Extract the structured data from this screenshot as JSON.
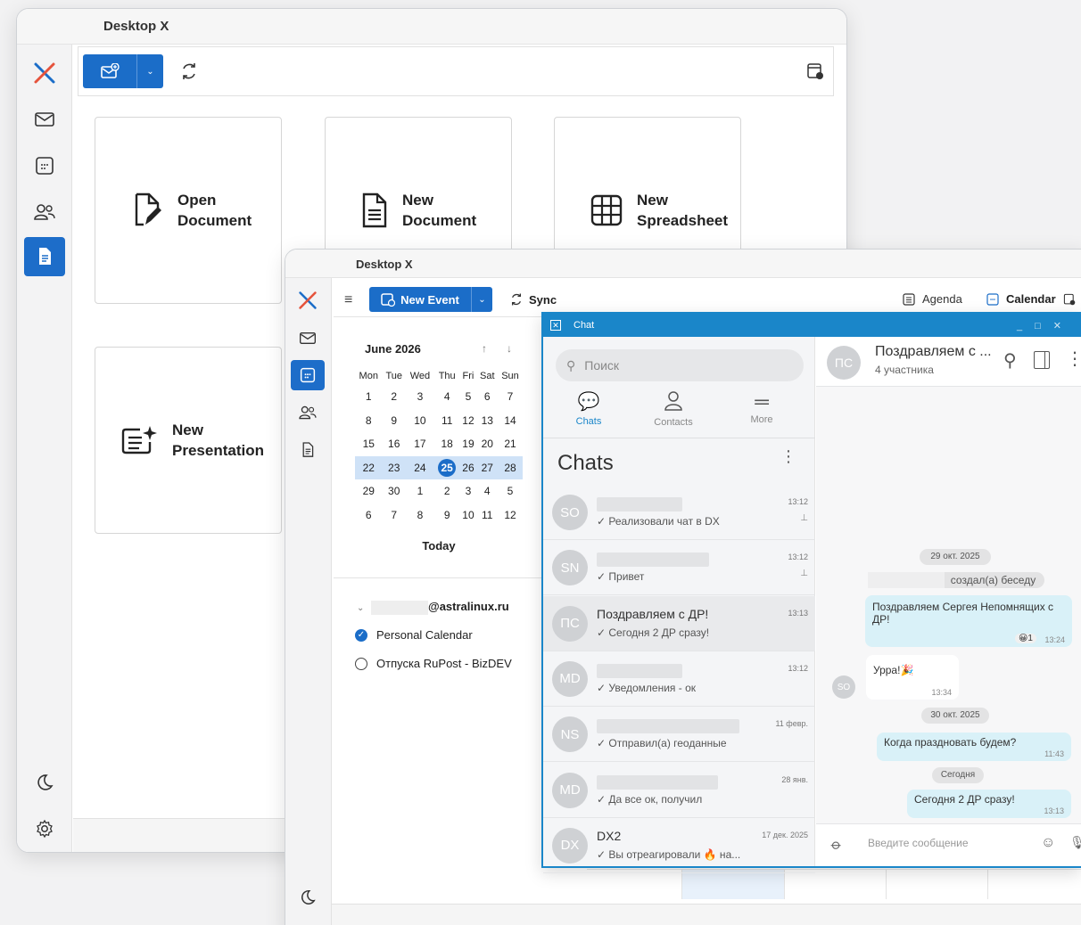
{
  "win1": {
    "title": "Desktop X",
    "tiles": [
      {
        "label": "Open\nDocument",
        "icon": "open-document-icon"
      },
      {
        "label": "New\nDocument",
        "icon": "new-document-icon"
      },
      {
        "label": "New\nSpreadsheet",
        "icon": "spreadsheet-icon"
      },
      {
        "label": "New\nPresentation",
        "icon": "presentation-icon"
      }
    ]
  },
  "win2": {
    "title": "Desktop X",
    "new_event": "New Event",
    "sync": "Sync",
    "agenda": "Agenda",
    "calendar": "Calendar",
    "month_label": "June 2026",
    "weekdays": [
      "Mon",
      "Tue",
      "Wed",
      "Thu",
      "Fri",
      "Sat",
      "Sun"
    ],
    "weeks": [
      [
        "1",
        "2",
        "3",
        "4",
        "5",
        "6",
        "7"
      ],
      [
        "8",
        "9",
        "10",
        "11",
        "12",
        "13",
        "14"
      ],
      [
        "15",
        "16",
        "17",
        "18",
        "19",
        "20",
        "21"
      ],
      [
        "22",
        "23",
        "24",
        "25",
        "26",
        "27",
        "28"
      ],
      [
        "29",
        "30",
        "1",
        "2",
        "3",
        "4",
        "5"
      ],
      [
        "6",
        "7",
        "8",
        "9",
        "10",
        "11",
        "12"
      ]
    ],
    "today_btn": "Today",
    "account_suffix": "@astralinux.ru",
    "calendars": [
      {
        "name": "Personal Calendar",
        "checked": true
      },
      {
        "name": "Отпуска RuPost - BizDEV",
        "checked": false
      }
    ]
  },
  "chat": {
    "window_title": "Chat",
    "search_placeholder": "Поиск",
    "tabs": [
      {
        "label": "Chats",
        "active": true
      },
      {
        "label": "Contacts",
        "active": false
      },
      {
        "label": "More",
        "active": false
      }
    ],
    "list_title": "Chats",
    "items": [
      {
        "initials": "SO",
        "name": "",
        "message": "✓ Реализовали чат в DX",
        "time": "13:12",
        "pinned": true,
        "color": "#cfd1d4"
      },
      {
        "initials": "SN",
        "name": "",
        "message": "✓ Привет",
        "time": "13:12",
        "pinned": true,
        "color": "#cfd1d4"
      },
      {
        "initials": "ПС",
        "name": "Поздравляем с ДР!",
        "message": "✓ Сегодня 2 ДР сразу!",
        "time": "13:13",
        "pinned": false,
        "color": "#cfd1d4"
      },
      {
        "initials": "MD",
        "name": "",
        "message": "✓ Уведомления - ок",
        "time": "13:12",
        "pinned": false,
        "color": "#cfd1d4"
      },
      {
        "initials": "NS",
        "name": "",
        "message": "✓ Отправил(а) геоданные",
        "time": "11 февр.",
        "pinned": false,
        "color": "#cfd1d4"
      },
      {
        "initials": "MD",
        "name": "",
        "message": "✓ Да все ок, получил",
        "time": "28 янв.",
        "pinned": false,
        "color": "#cfd1d4"
      },
      {
        "initials": "DX",
        "name": "DX2",
        "message": "✓ Вы отреагировали 🔥 на...",
        "time": "17 дек. 2025",
        "pinned": false,
        "color": "#cfd1d4"
      }
    ],
    "header": {
      "initials": "ПС",
      "title": "Поздравляем с ...",
      "subtitle": "4 участника"
    },
    "messages": {
      "date1": "29 окт. 2025",
      "created": "создал(а) беседу",
      "congrats": "Поздравляем Сергея Непомнящих с ДР!",
      "congrats_reaction": "😀1",
      "congrats_time": "13:24",
      "hooray_avatar": "SO",
      "hooray": "Урра!🎉",
      "hooray_time": "13:34",
      "date2": "30 окт. 2025",
      "when": "Когда праздновать будем?",
      "when_time": "11:43",
      "today": "Сегодня",
      "today_msg": "Сегодня 2 ДР сразу!",
      "today_time": "13:13"
    },
    "input_placeholder": "Введите сообщение"
  }
}
